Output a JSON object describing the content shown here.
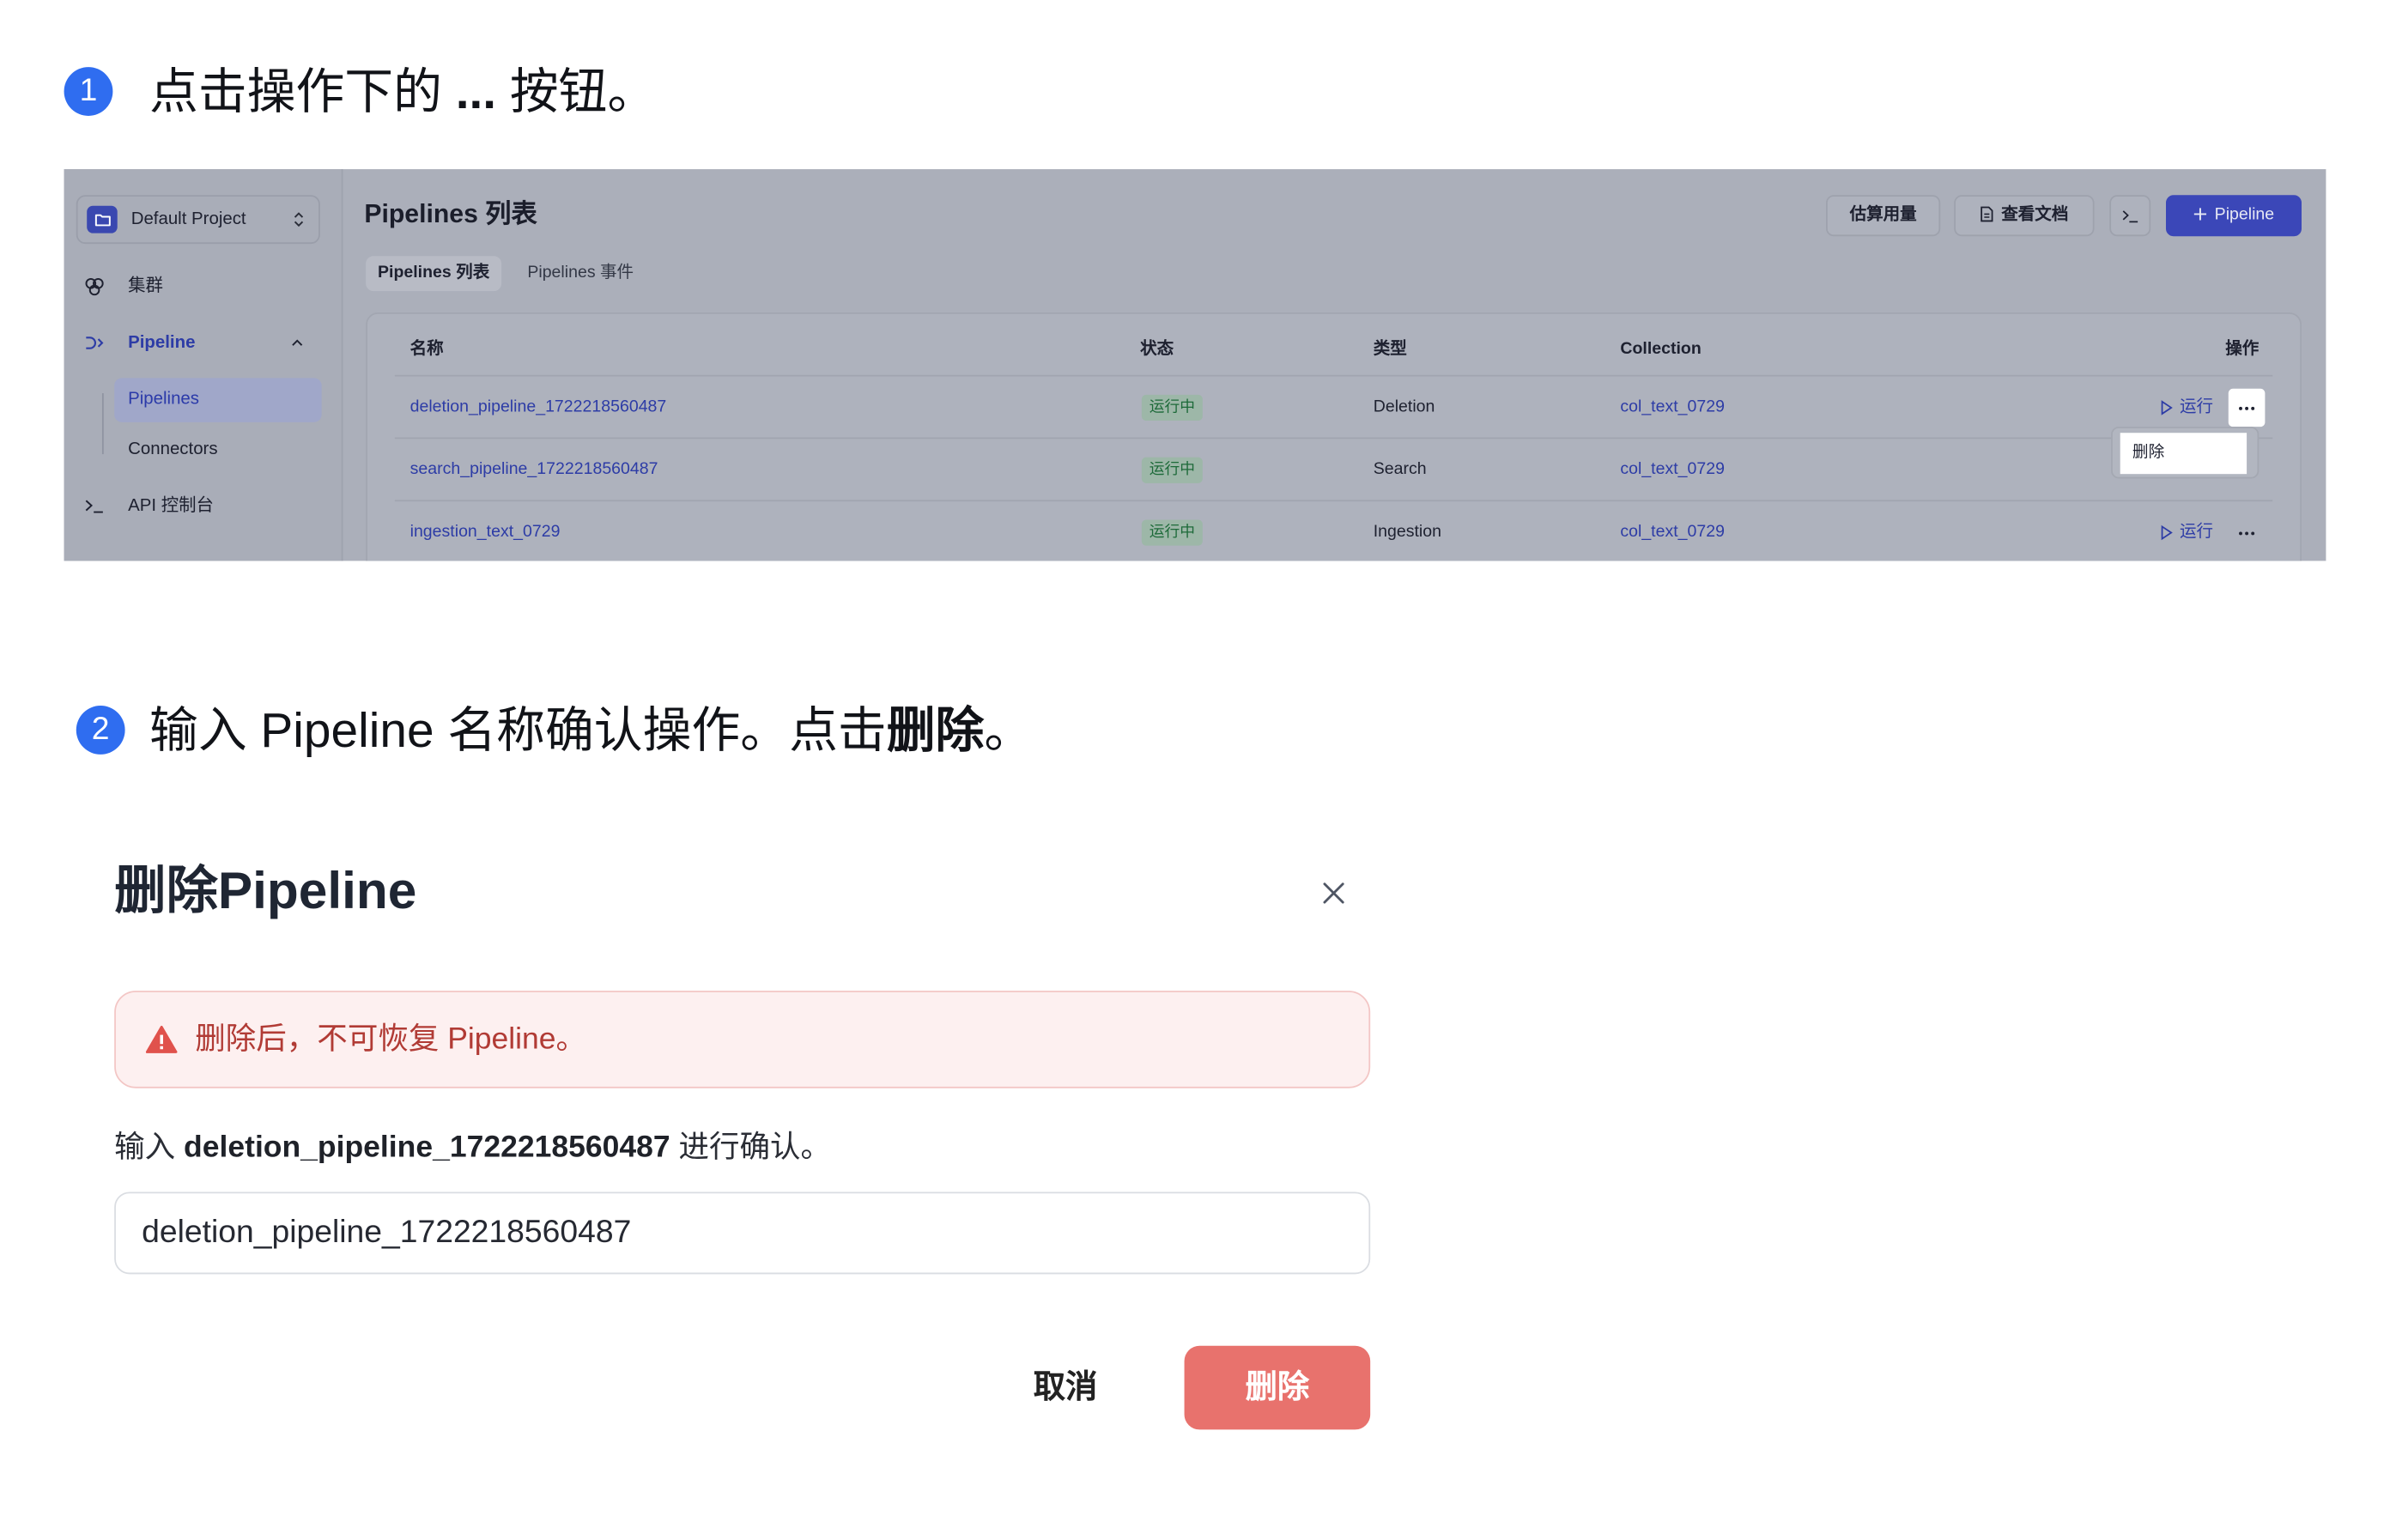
{
  "steps": [
    {
      "number": "1",
      "text_before": "点击操作下的 ",
      "text_bold": "...",
      "text_after": " 按钮。"
    },
    {
      "number": "2",
      "text_before": "输入 Pipeline 名称确认操作。点击",
      "text_bold": "删除",
      "text_after": "。"
    }
  ],
  "screenshot": {
    "sidebar": {
      "project": {
        "icon": "folder-icon",
        "name": "Default Project"
      },
      "items": [
        {
          "icon": "cluster-icon",
          "label": "集群"
        },
        {
          "icon": "pipeline-icon",
          "label": "Pipeline",
          "expanded": true,
          "children": [
            {
              "label": "Pipelines",
              "active": true
            },
            {
              "label": "Connectors",
              "active": false
            }
          ]
        },
        {
          "icon": "terminal-icon",
          "label": "API 控制台"
        }
      ]
    },
    "page_title": "Pipelines 列表",
    "toolbar": {
      "estimate_label": "估算用量",
      "docs_label": "查看文档",
      "docs_icon": "document-icon",
      "console_icon": "terminal-icon",
      "create_icon": "plus-icon",
      "create_label": "Pipeline"
    },
    "tabs": [
      {
        "label": "Pipelines 列表",
        "active": true
      },
      {
        "label": "Pipelines 事件",
        "active": false
      }
    ],
    "table": {
      "columns": [
        "名称",
        "状态",
        "类型",
        "Collection",
        "操作"
      ],
      "rows": [
        {
          "name": "deletion_pipeline_1722218560487",
          "status": "运行中",
          "type": "Deletion",
          "collection": "col_text_0729",
          "action": "运行"
        },
        {
          "name": "search_pipeline_1722218560487",
          "status": "运行中",
          "type": "Search",
          "collection": "col_text_0729",
          "action": "运行"
        },
        {
          "name": "ingestion_text_0729",
          "status": "运行中",
          "type": "Ingestion",
          "collection": "col_text_0729",
          "action": "运行"
        }
      ],
      "action_icon": "play-icon",
      "more_icon": "more-icon"
    },
    "row_menu": {
      "items": [
        "删除"
      ]
    }
  },
  "dialog": {
    "title": "删除Pipeline",
    "close_icon": "close-icon",
    "alert_icon": "warning-icon",
    "alert": "删除后，不可恢复 Pipeline。",
    "confirm_prefix": "输入 ",
    "confirm_name": "deletion_pipeline_1722218560487",
    "confirm_suffix": " 进行确认。",
    "input_value": "deletion_pipeline_1722218560487",
    "cancel_label": "取消",
    "delete_label": "删除"
  },
  "colors": {
    "step_badge": "#2f6df0",
    "primary_button": "#3b47b8",
    "link": "#2d3ca6",
    "alert_background": "#fdf0f0",
    "alert_text": "#b13b35",
    "danger_button": "#e8726d"
  }
}
